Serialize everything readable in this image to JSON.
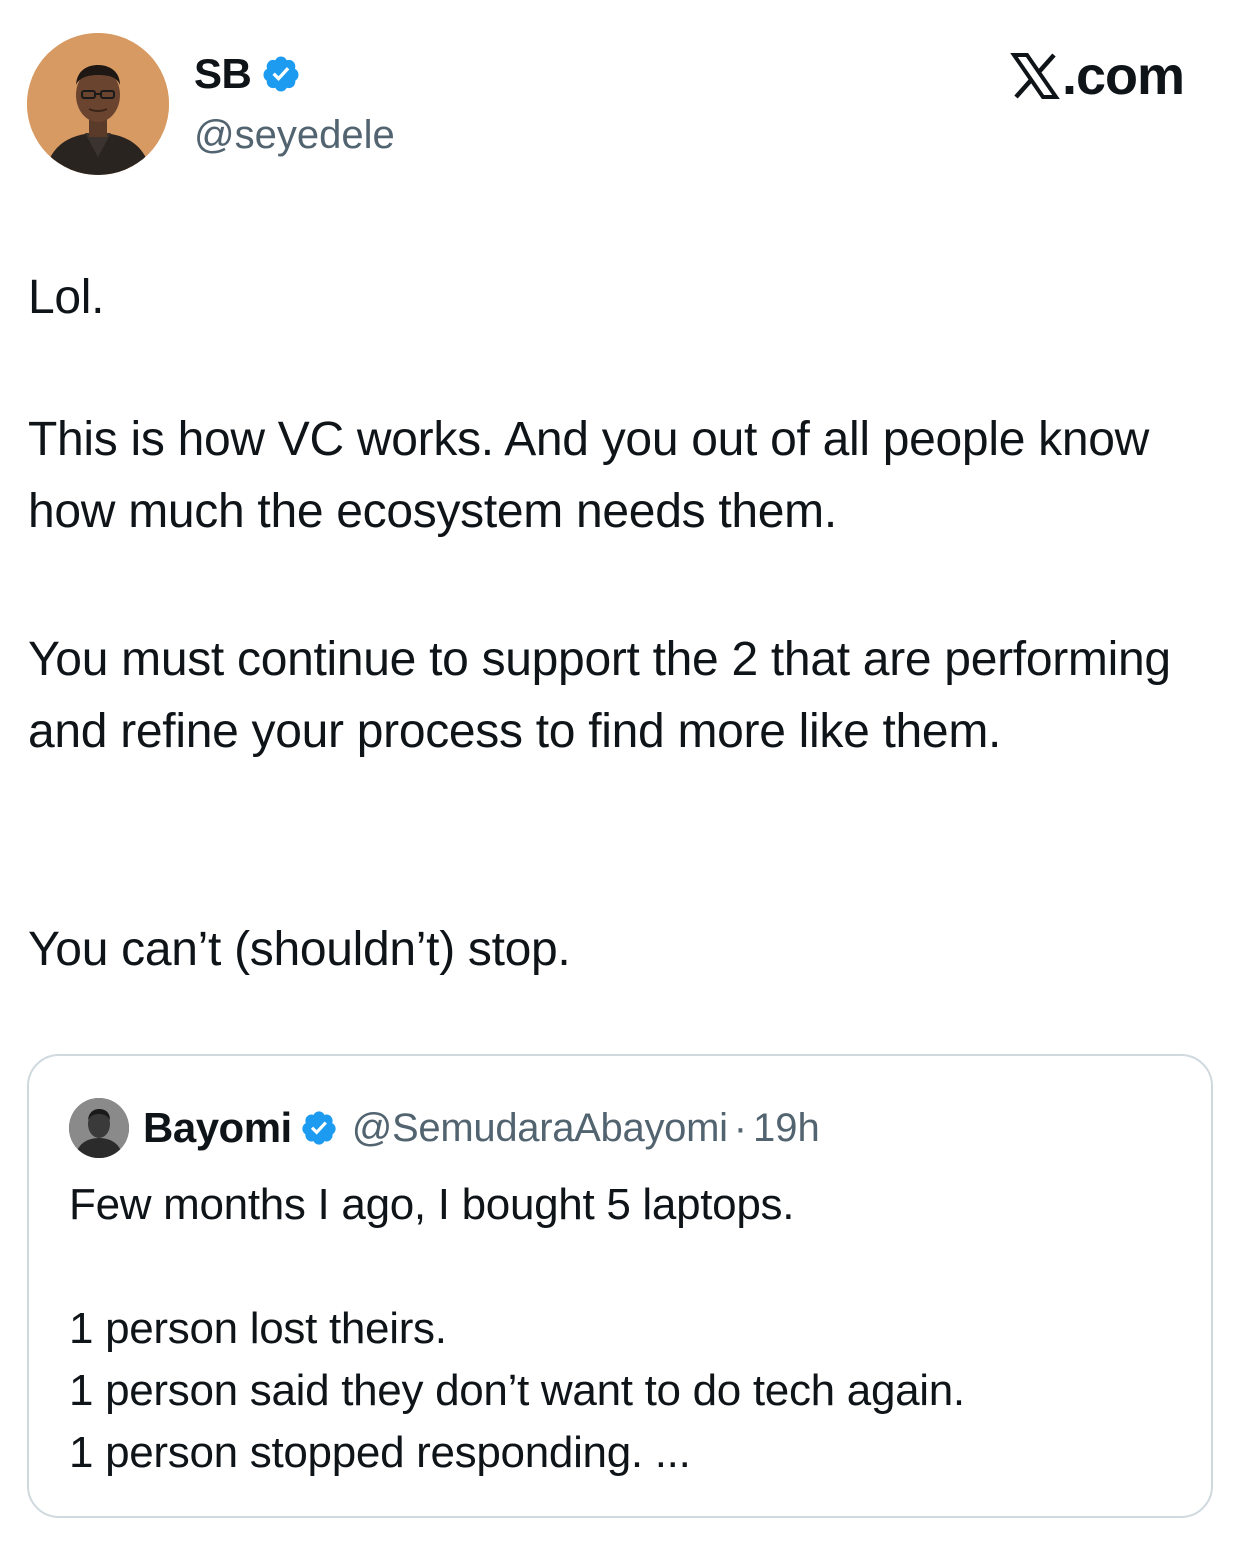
{
  "author": {
    "name": "SB",
    "handle": "@seyedele",
    "verified": true,
    "avatar_icon": "person-avatar"
  },
  "brand": {
    "label": ".com",
    "icon": "x-logo-icon"
  },
  "tweet": {
    "paragraphs": [
      "Lol.",
      "This is how VC works. And you out of all people know how much the ecosystem needs them.",
      "You must continue to support the 2 that are performing and refine your process to find more like them.",
      "You can’t (shouldn’t) stop."
    ]
  },
  "quoted": {
    "name": "Bayomi",
    "handle": "@SemudaraAbayomi",
    "separator": "·",
    "time": "19h",
    "verified": true,
    "lines": [
      "Few months I ago, I bought 5 laptops.",
      "1 person lost theirs.",
      "1 person said they don’t want to do tech again.",
      "1 person stopped responding. ..."
    ]
  },
  "colors": {
    "verified_blue": "#1d9bf0",
    "text": "#0f1419",
    "secondary": "#536471",
    "border": "#cfd9de"
  }
}
